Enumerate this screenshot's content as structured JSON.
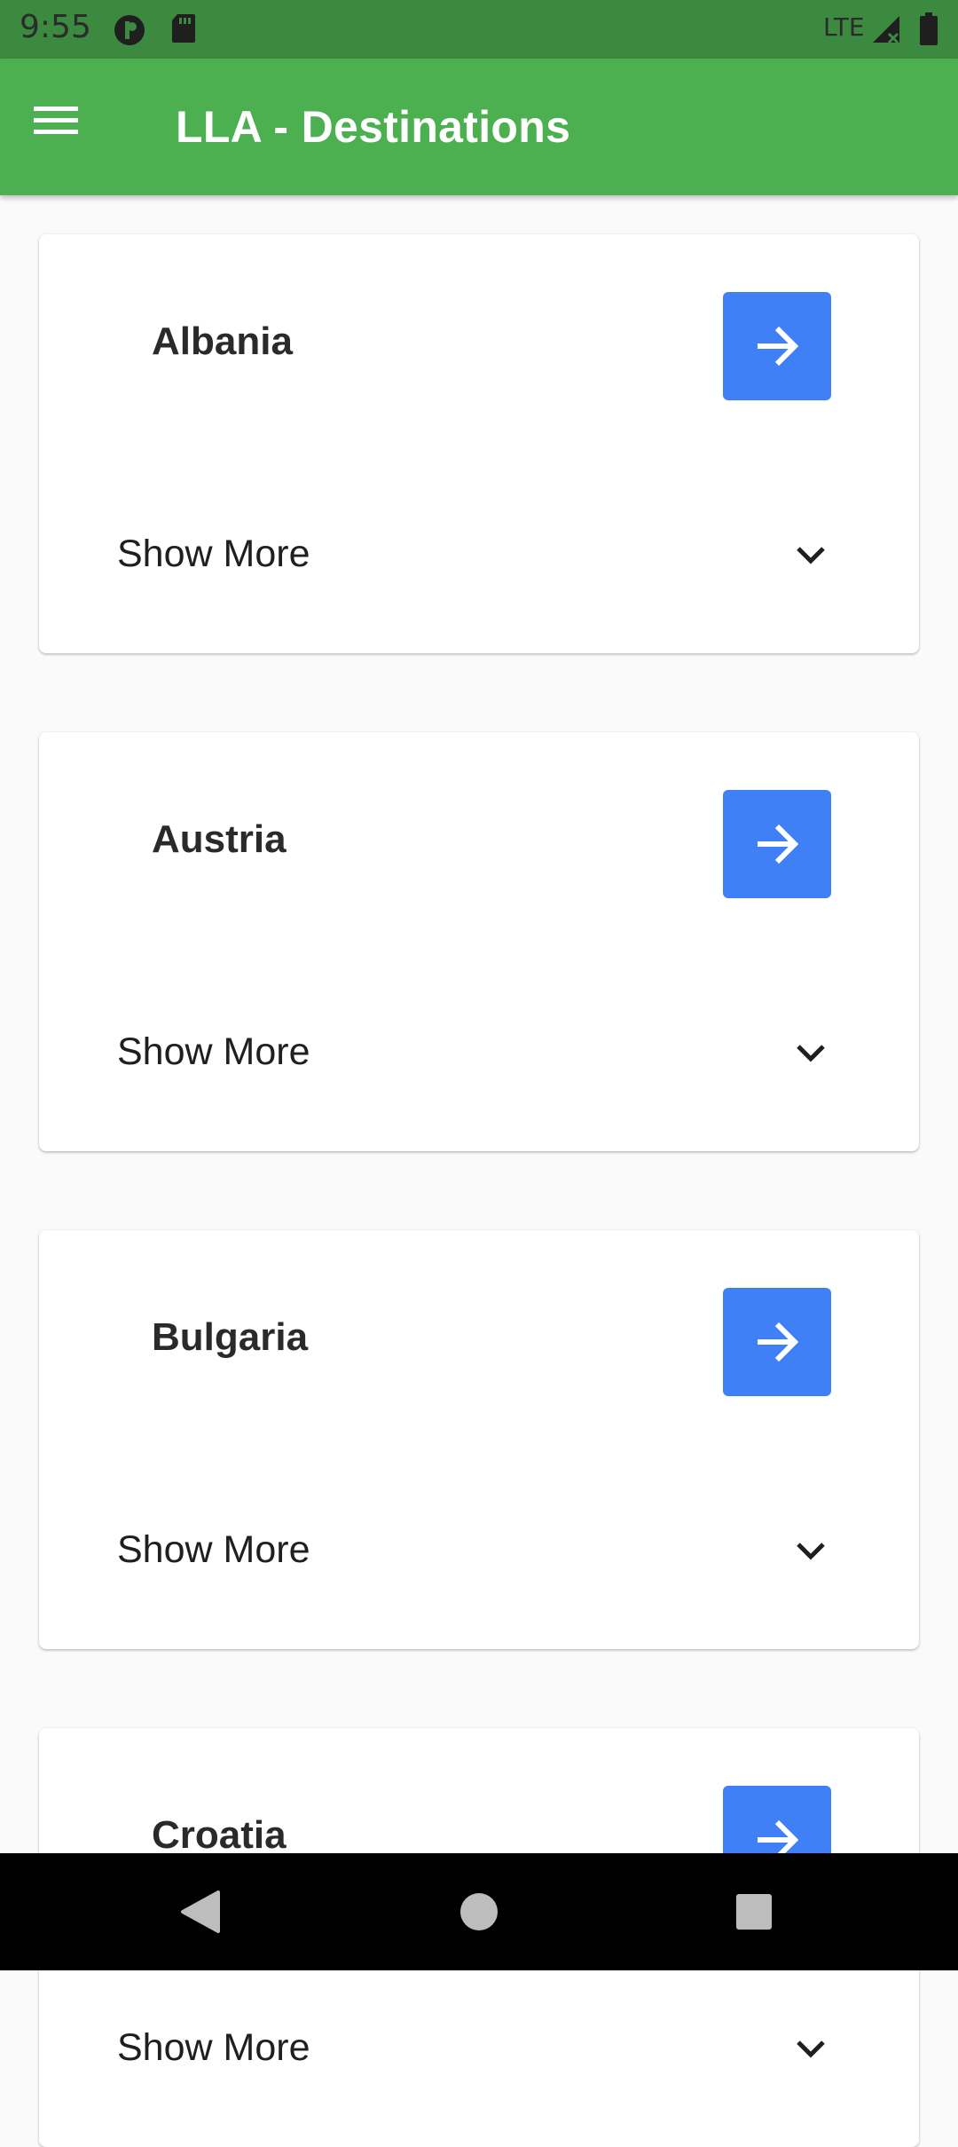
{
  "status_bar": {
    "time": "9:55",
    "network": "LTE",
    "icons": [
      "privacy-icon",
      "sd-card-icon",
      "signal-icon",
      "battery-icon"
    ]
  },
  "app_bar": {
    "title": "LLA - Destinations",
    "menu_icon": "menu-icon",
    "color": "#4caf50"
  },
  "destinations": [
    {
      "name": "Albania",
      "show_more_label": "Show More"
    },
    {
      "name": "Austria",
      "show_more_label": "Show More"
    },
    {
      "name": "Bulgaria",
      "show_more_label": "Show More"
    },
    {
      "name": "Croatia",
      "show_more_label": "Show More"
    }
  ],
  "colors": {
    "accent_button": "#3f80f7",
    "status_bar": "#3c8a3f",
    "background": "#fafafa"
  },
  "nav": {
    "icons": [
      "back-icon",
      "home-icon",
      "recents-icon"
    ]
  }
}
